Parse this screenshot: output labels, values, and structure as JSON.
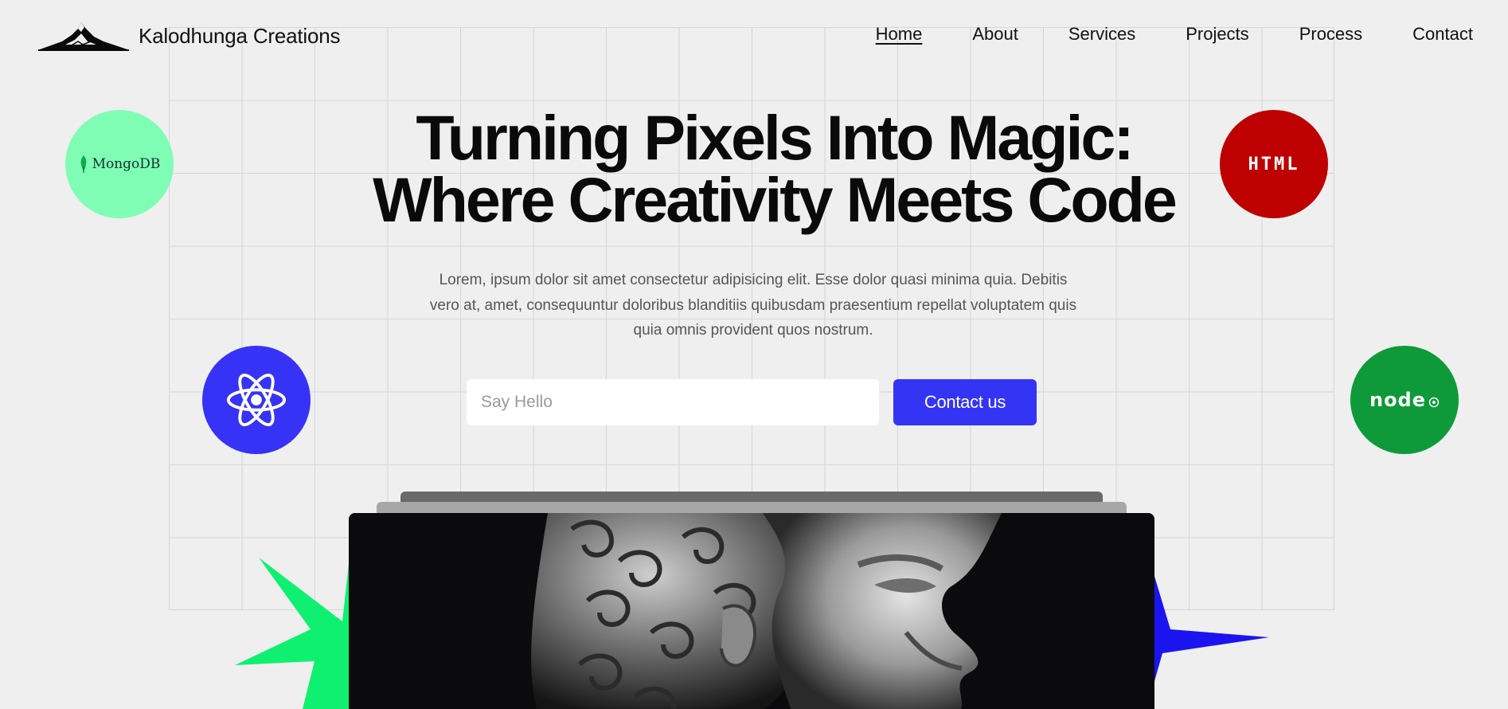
{
  "brand": {
    "name": "Kalodhunga Creations",
    "logo_icon": "mountain-icon"
  },
  "nav": {
    "items": [
      {
        "label": "Home",
        "active": true
      },
      {
        "label": "About",
        "active": false
      },
      {
        "label": "Services",
        "active": false
      },
      {
        "label": "Projects",
        "active": false
      },
      {
        "label": "Process",
        "active": false
      },
      {
        "label": "Contact",
        "active": false
      }
    ]
  },
  "hero": {
    "headline_line1": "Turning Pixels Into Magic:",
    "headline_line2": "Where Creativity Meets Code",
    "description": "Lorem, ipsum dolor sit amet consectetur adipisicing elit. Esse dolor quasi minima quia. Debitis vero at, amet, consequuntur doloribus blanditiis quibusdam praesentium repellat voluptatem quis quia omnis provident quos nostrum.",
    "input_placeholder": "Say Hello",
    "cta_label": "Contact us"
  },
  "badges": {
    "mongodb": {
      "label": "MongoDB",
      "color": "#7ffdb4",
      "icon": "leaf-icon"
    },
    "html": {
      "label": "HTML",
      "color": "#bd0000"
    },
    "react": {
      "color": "#3633f6",
      "icon": "react-atom-icon"
    },
    "node": {
      "label": "node",
      "color": "#0e9a39"
    }
  },
  "colors": {
    "accent": "#3434f5",
    "star_green": "#0ff070",
    "star_blue": "#1c14f0",
    "background": "#efefef"
  },
  "hero_image": {
    "subject": "statue-head-image"
  }
}
